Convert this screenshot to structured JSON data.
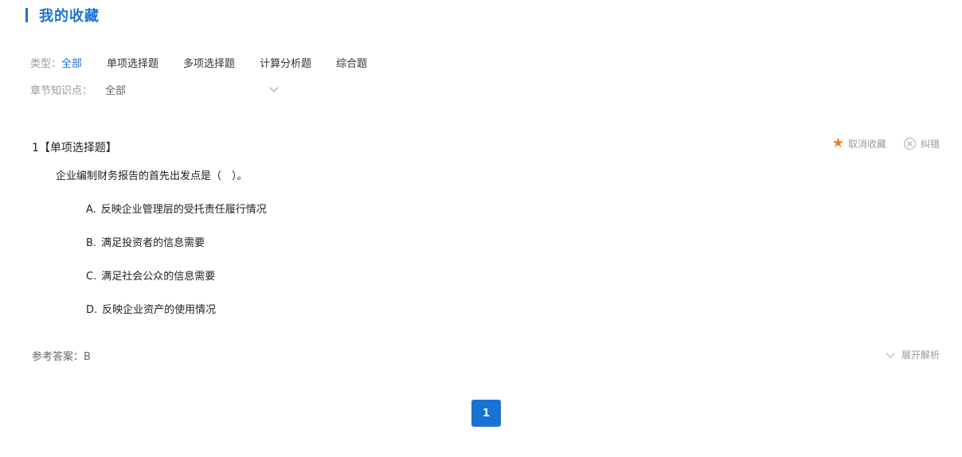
{
  "header": {
    "title": "我的收藏"
  },
  "filters": {
    "type_label": "类型：",
    "type_options": [
      "全部",
      "单项选择题",
      "多项选择题",
      "计算分析题",
      "综合题"
    ],
    "type_selected": "全部",
    "chapter_label": "章节知识点：",
    "chapter_value": "全部"
  },
  "question": {
    "header": "1【单项选择题】",
    "stem": "企业编制财务报告的首先出发点是（　）。",
    "options": [
      {
        "letter": "A.",
        "text": "反映企业管理层的受托责任履行情况"
      },
      {
        "letter": "B.",
        "text": "满足投资者的信息需要"
      },
      {
        "letter": "C.",
        "text": "满足社会公众的信息需要"
      },
      {
        "letter": "D.",
        "text": "反映企业资产的使用情况"
      }
    ],
    "actions": {
      "unfavorite_label": "取消收藏",
      "report_label": "纠错"
    },
    "answer_text": "参考答案：B",
    "expand_label": "展开解析"
  },
  "pagination": {
    "current_page": "1"
  },
  "colors": {
    "accent": "#1a73d4",
    "star": "#f07c1e"
  }
}
